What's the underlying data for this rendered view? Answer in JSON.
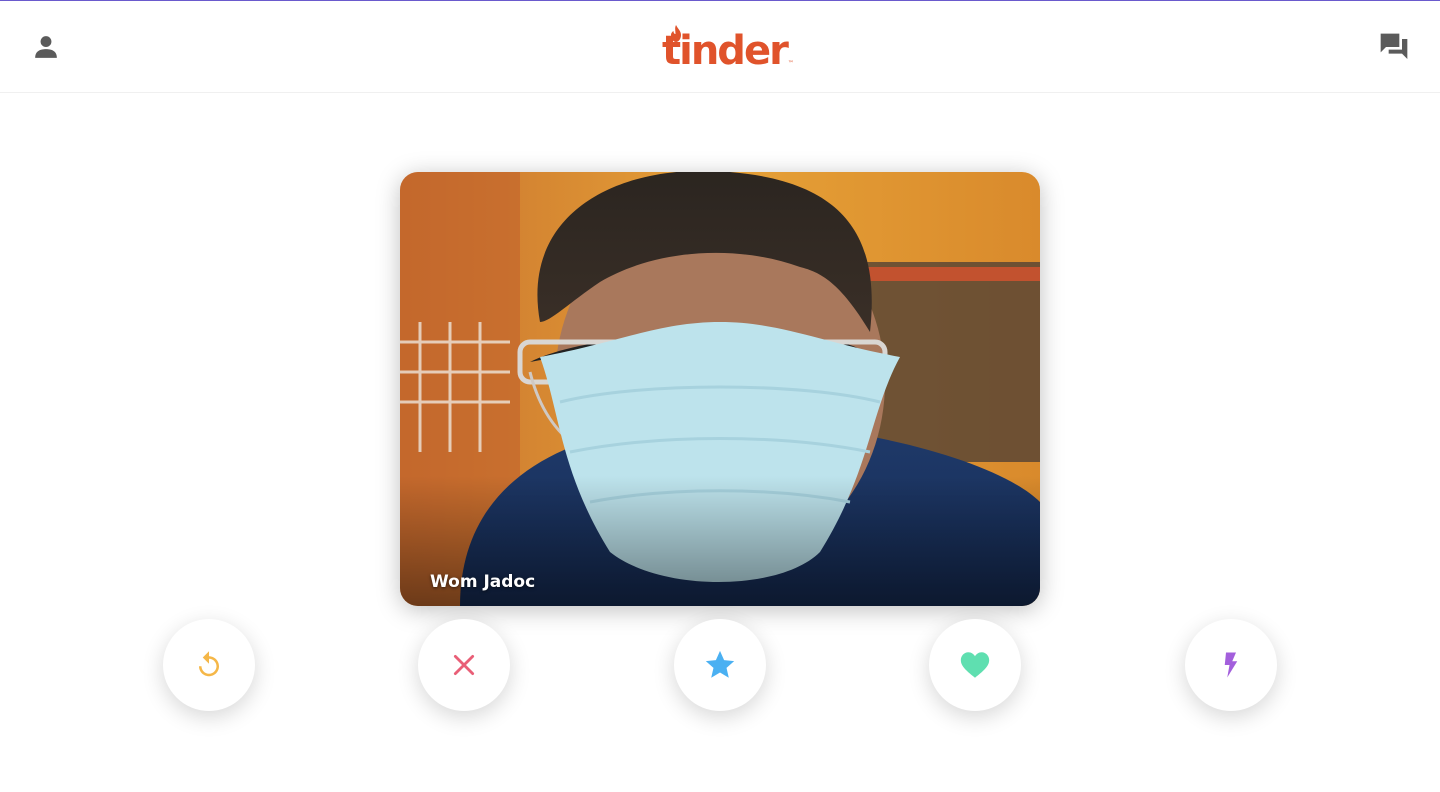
{
  "app": {
    "logo_text": "tinder",
    "logo_tm": "™",
    "brand_color": "#e0532b"
  },
  "header": {
    "profile_icon": "person-icon",
    "messages_icon": "chat-bubbles-icon"
  },
  "card": {
    "name": "Wom Jadoc"
  },
  "actions": [
    {
      "id": "rewind",
      "icon": "rewind-icon",
      "color": "#f5b748"
    },
    {
      "id": "nope",
      "icon": "close-icon",
      "color": "#e95f77"
    },
    {
      "id": "super-like",
      "icon": "star-icon",
      "color": "#4ab0f2"
    },
    {
      "id": "like",
      "icon": "heart-icon",
      "color": "#5fdfb0"
    },
    {
      "id": "boost",
      "icon": "lightning-icon",
      "color": "#a35fdc"
    }
  ]
}
